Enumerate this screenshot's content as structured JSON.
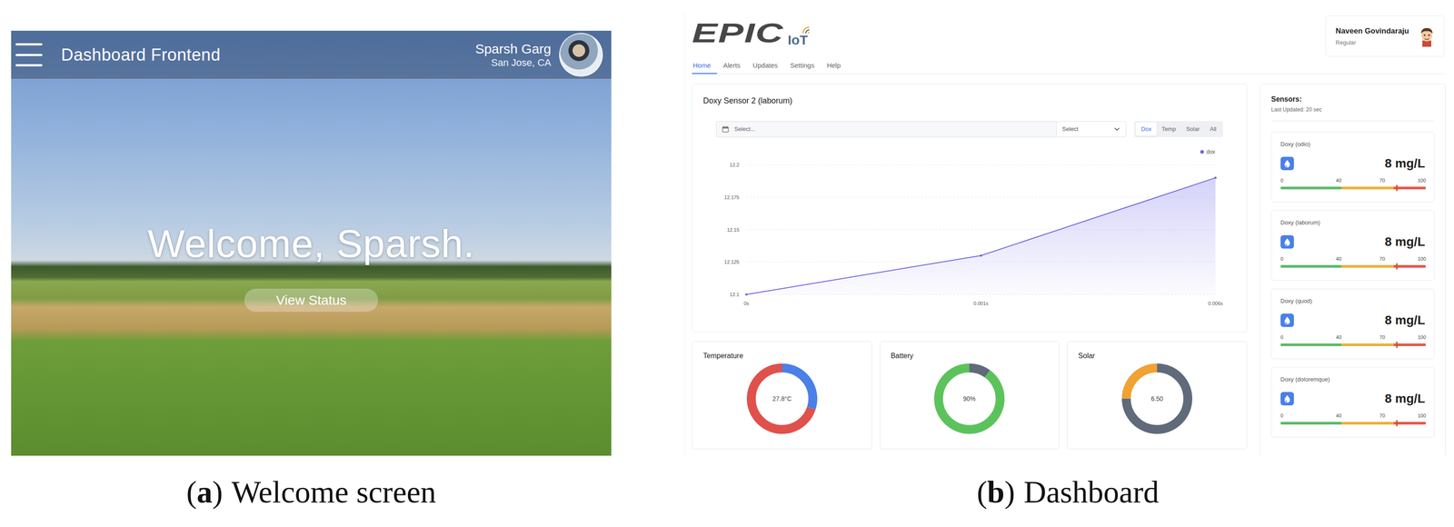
{
  "welcome": {
    "header": {
      "title": "Dashboard Frontend",
      "user_name": "Sparsh Garg",
      "user_location": "San Jose, CA"
    },
    "greeting": "Welcome, Sparsh.",
    "button": "View Status",
    "caption": {
      "open": "(",
      "label": "a",
      "close": ")",
      "text": "Welcome screen"
    }
  },
  "dashboard": {
    "logo": {
      "text": "EPIC",
      "suffix": "IoT"
    },
    "user": {
      "name": "Naveen Govindaraju",
      "role": "Regular"
    },
    "tabs": [
      {
        "label": "Home",
        "selected": true
      },
      {
        "label": "Alerts",
        "selected": false
      },
      {
        "label": "Updates",
        "selected": false
      },
      {
        "label": "Settings",
        "selected": false
      },
      {
        "label": "Help",
        "selected": false
      }
    ],
    "chart": {
      "title": "Doxy Sensor 2 (laborum)",
      "date_placeholder": "Select...",
      "select": "Select",
      "series_buttons": [
        {
          "label": "Dox",
          "selected": true
        },
        {
          "label": "Temp",
          "selected": false
        },
        {
          "label": "Solar",
          "selected": false
        },
        {
          "label": "All",
          "selected": false
        }
      ],
      "legend": "dox",
      "y_ticks": [
        "12.2",
        "12.175",
        "12.15",
        "12.125",
        "12.1"
      ],
      "x_ticks": [
        "0s",
        "0.001s",
        "0.006s"
      ],
      "series": [
        {
          "name": "dox",
          "values": [
            12.1,
            12.13,
            12.19
          ]
        }
      ]
    },
    "gauges": [
      {
        "title": "Temperature",
        "value": "27.8°C",
        "segments": [
          {
            "level": 0.3,
            "color": "#4a80e8"
          },
          {
            "level": 0.7,
            "color": "#e0514b"
          }
        ]
      },
      {
        "title": "Battery",
        "value": "90%",
        "segments": [
          {
            "level": 0.1,
            "color": "#5f6b7a"
          },
          {
            "level": 0.9,
            "color": "#5cc35c"
          }
        ]
      },
      {
        "title": "Solar",
        "value": "6.50",
        "segments": [
          {
            "level": 0.75,
            "color": "#5f6b7a"
          },
          {
            "level": 0.25,
            "color": "#f0a232"
          }
        ]
      }
    ],
    "sensors": {
      "title": "Sensors:",
      "updated": "Last Updated: 20 sec",
      "items": [
        {
          "name": "Doxy (odio)",
          "value": "8 mg/L",
          "scale": [
            "0",
            "40",
            "70",
            "100"
          ],
          "level": 0.8
        },
        {
          "name": "Doxy (laborum)",
          "value": "8 mg/L",
          "scale": [
            "0",
            "40",
            "70",
            "100"
          ],
          "level": 0.8
        },
        {
          "name": "Doxy (quod)",
          "value": "8 mg/L",
          "scale": [
            "0",
            "40",
            "70",
            "100"
          ],
          "level": 0.8
        },
        {
          "name": "Doxy (doloremque)",
          "value": "8 mg/L",
          "scale": [
            "0",
            "40",
            "70",
            "100"
          ],
          "level": 0.8
        }
      ]
    },
    "caption": {
      "open": "(",
      "label": "b",
      "close": ")",
      "text": "Dashboard"
    }
  }
}
